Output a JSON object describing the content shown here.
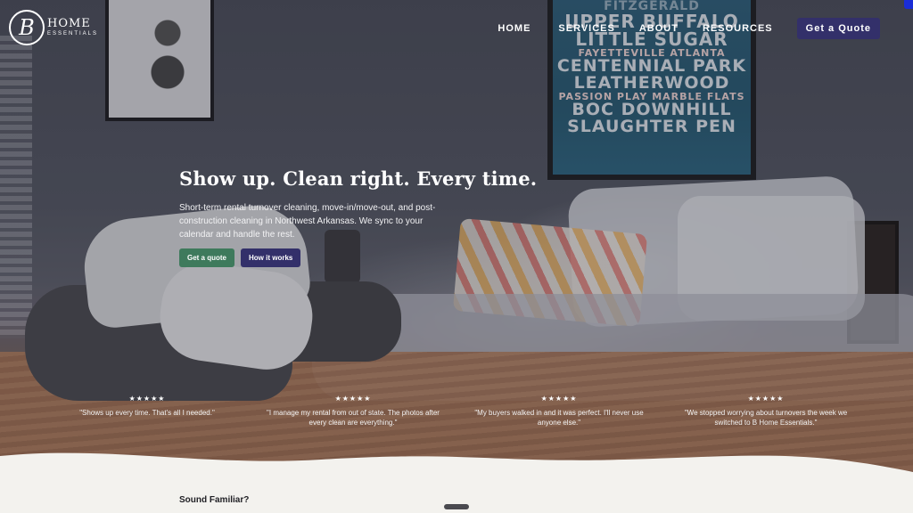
{
  "logo": {
    "letter": "B",
    "main": "HOME",
    "sub": "ESSENTIALS"
  },
  "nav": {
    "items": [
      "HOME",
      "SERVICES",
      "ABOUT",
      "RESOURCES"
    ],
    "quote_button": "Get a Quote"
  },
  "hero": {
    "title": "Show up. Clean right. Every time.",
    "subtitle": "Short-term rental turnover cleaning, move-in/move-out, and post-construction cleaning in Northwest Arkansas. We sync to your calendar and handle the rest.",
    "primary_button": "Get a quote",
    "secondary_button": "How it works"
  },
  "poster": {
    "lines": [
      "FITZGERALD",
      "UPPER BUFFALO",
      "LITTLE SUGAR",
      "FAYETTEVILLE ATLANTA",
      "CENTENNIAL PARK",
      "LEATHERWOOD",
      "PASSION PLAY MARBLE FLATS",
      "BOC DOWNHILL",
      "SLAUGHTER PEN"
    ]
  },
  "testimonials": [
    {
      "stars": "★★★★★",
      "quote": "\"Shows up every time. That's all I needed.\""
    },
    {
      "stars": "★★★★★",
      "quote": "\"I manage my rental from out of state. The photos after every clean are everything.\""
    },
    {
      "stars": "★★★★★",
      "quote": "\"My buyers walked in and it was perfect. I'll never use anyone else.\""
    },
    {
      "stars": "★★★★★",
      "quote": "\"We stopped worrying about turnovers the week we switched to B Home Essentials.\""
    }
  ],
  "section": {
    "heading": "Sound Familiar?"
  },
  "colors": {
    "accent_purple": "#33306a",
    "accent_green": "#3e7a5c",
    "wave": "#f3f2ee"
  }
}
